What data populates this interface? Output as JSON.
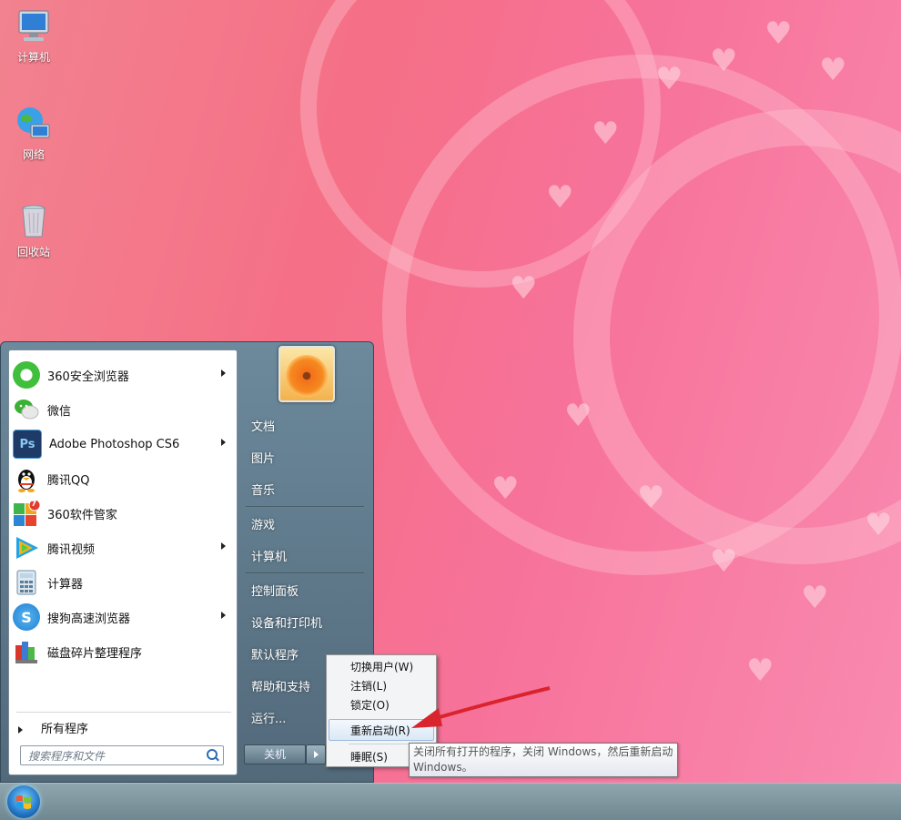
{
  "desktop_icons": [
    {
      "label": "计算机",
      "icon": "computer-icon"
    },
    {
      "label": "网络",
      "icon": "network-icon"
    },
    {
      "label": "回收站",
      "icon": "recycle-bin-icon"
    }
  ],
  "start_menu": {
    "programs": [
      {
        "label": "360安全浏览器",
        "icon": "360-browser-icon",
        "has_submenu": true
      },
      {
        "label": "微信",
        "icon": "wechat-icon",
        "has_submenu": false
      },
      {
        "label": "Adobe Photoshop CS6",
        "icon": "photoshop-icon",
        "icon_text": "Ps",
        "has_submenu": true
      },
      {
        "label": "腾讯QQ",
        "icon": "qq-icon",
        "has_submenu": false
      },
      {
        "label": "360软件管家",
        "icon": "360-software-manager-icon",
        "badge": "7",
        "has_submenu": false
      },
      {
        "label": "腾讯视频",
        "icon": "tencent-video-icon",
        "has_submenu": true
      },
      {
        "label": "计算器",
        "icon": "calculator-icon",
        "has_submenu": false
      },
      {
        "label": "搜狗高速浏览器",
        "icon": "sogou-browser-icon",
        "has_submenu": true
      },
      {
        "label": "磁盘碎片整理程序",
        "icon": "disk-defragmenter-icon",
        "has_submenu": false
      }
    ],
    "all_programs": "所有程序",
    "search_placeholder": "搜索程序和文件",
    "right_items": [
      "文档",
      "图片",
      "音乐",
      "游戏",
      "计算机",
      "控制面板",
      "设备和打印机",
      "默认程序",
      "帮助和支持",
      "运行..."
    ],
    "shutdown_label": "关机"
  },
  "power_submenu": {
    "items": [
      "切换用户(W)",
      "注销(L)",
      "锁定(O)",
      "重新启动(R)",
      "睡眠(S)"
    ],
    "highlighted": "重新启动(R)"
  },
  "tooltip": {
    "line1": "关闭所有打开的程序，关闭 Windows，然后重新启动",
    "line2": "Windows。"
  },
  "colors": {
    "arrow": "#d9242e",
    "photoshop": "#1d3b66",
    "qq_badge": "#e33b2f"
  }
}
